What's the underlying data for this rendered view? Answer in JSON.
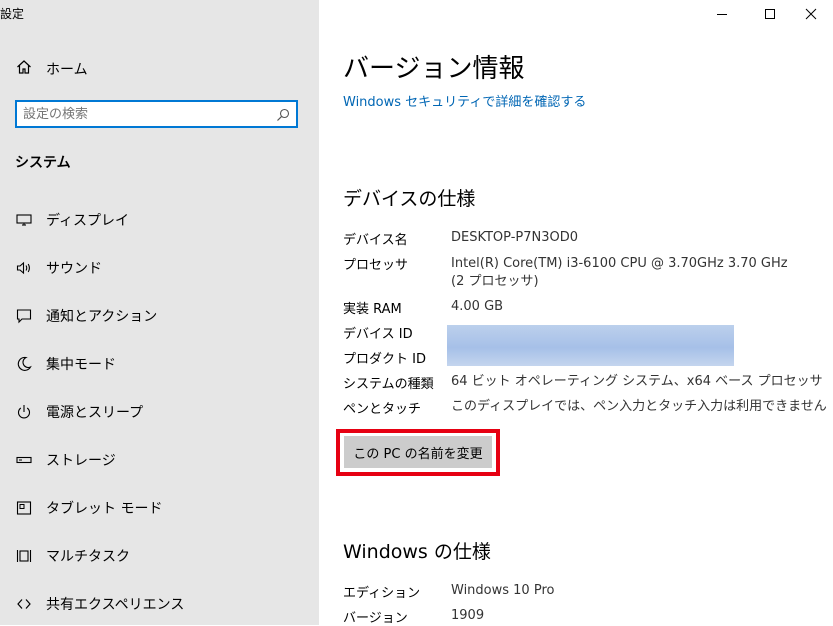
{
  "app": {
    "title": "設定"
  },
  "window": {
    "minimize_icon": "minimize-icon",
    "maximize_icon": "maximize-icon",
    "close_icon": "close-icon"
  },
  "sidebar": {
    "home_label": "ホーム",
    "search": {
      "placeholder": "設定の検索",
      "value": ""
    },
    "section_title": "システム",
    "items": [
      {
        "label": "ディスプレイ",
        "icon": "display-icon"
      },
      {
        "label": "サウンド",
        "icon": "sound-icon"
      },
      {
        "label": "通知とアクション",
        "icon": "notification-icon"
      },
      {
        "label": "集中モード",
        "icon": "focus-assist-icon"
      },
      {
        "label": "電源とスリープ",
        "icon": "power-icon"
      },
      {
        "label": "ストレージ",
        "icon": "storage-icon"
      },
      {
        "label": "タブレット モード",
        "icon": "tablet-mode-icon"
      },
      {
        "label": "マルチタスク",
        "icon": "multitasking-icon"
      },
      {
        "label": "共有エクスペリエンス",
        "icon": "shared-experiences-icon"
      }
    ]
  },
  "main": {
    "title": "バージョン情報",
    "security_link": "Windows セキュリティで詳細を確認する",
    "device_spec": {
      "heading": "デバイスの仕様",
      "rows": [
        {
          "label": "デバイス名",
          "value": "DESKTOP-P7N3OD0"
        },
        {
          "label": "プロセッサ",
          "value": "Intel(R) Core(TM) i3-6100 CPU @ 3.70GHz   3.70 GHz",
          "value2": "(2 プロセッサ)"
        },
        {
          "label": "実装 RAM",
          "value": "4.00 GB"
        },
        {
          "label": "デバイス ID",
          "value": ""
        },
        {
          "label": "プロダクト ID",
          "value": ""
        },
        {
          "label": "システムの種類",
          "value": "64 ビット オペレーティング システム、x64 ベース プロセッサ"
        },
        {
          "label": "ペンとタッチ",
          "value": "このディスプレイでは、ペン入力とタッチ入力は利用できません"
        }
      ],
      "rename_button": "この PC の名前を変更"
    },
    "windows_spec": {
      "heading": "Windows の仕様",
      "rows": [
        {
          "label": "エディション",
          "value": "Windows 10 Pro"
        },
        {
          "label": "バージョン",
          "value": "1909"
        }
      ]
    }
  },
  "colors": {
    "accent": "#0078d4",
    "link": "#0066b4",
    "highlight_frame": "#e60012",
    "sidebar_bg": "#e6e6e6"
  }
}
